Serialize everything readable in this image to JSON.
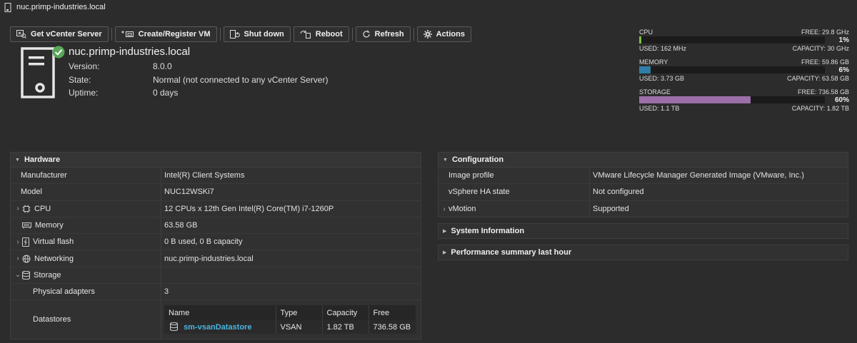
{
  "window": {
    "title": "nuc.primp-industries.local"
  },
  "toolbar": {
    "get_vcenter": "Get vCenter Server",
    "create_vm": "Create/Register VM",
    "shut_down": "Shut down",
    "reboot": "Reboot",
    "refresh": "Refresh",
    "actions": "Actions"
  },
  "host": {
    "name": "nuc.primp-industries.local",
    "version_label": "Version:",
    "version": "8.0.0",
    "state_label": "State:",
    "state": "Normal (not connected to any vCenter Server)",
    "uptime_label": "Uptime:",
    "uptime": "0 days"
  },
  "gauges": {
    "cpu": {
      "label": "CPU",
      "free": "FREE: 29.8 GHz",
      "pct": "1%",
      "used": "USED: 162 MHz",
      "capacity": "CAPACITY: 30 GHz",
      "fraction": 0.01,
      "color": "#7ac142"
    },
    "memory": {
      "label": "MEMORY",
      "free": "FREE: 59.86 GB",
      "pct": "6%",
      "used": "USED: 3.73 GB",
      "capacity": "CAPACITY: 63.58 GB",
      "fraction": 0.06,
      "color": "#2f7ea8"
    },
    "storage": {
      "label": "STORAGE",
      "free": "FREE: 736.58 GB",
      "pct": "60%",
      "used": "USED: 1.1 TB",
      "capacity": "CAPACITY: 1.82 TB",
      "fraction": 0.6,
      "color": "#9c6fa8"
    }
  },
  "hardware": {
    "title": "Hardware",
    "manufacturer_label": "Manufacturer",
    "manufacturer": "Intel(R) Client Systems",
    "model_label": "Model",
    "model": "NUC12WSKi7",
    "cpu_label": "CPU",
    "cpu": "12 CPUs x 12th Gen Intel(R) Core(TM) i7-1260P",
    "memory_label": "Memory",
    "memory": "63.58 GB",
    "vflash_label": "Virtual flash",
    "vflash": "0 B used, 0 B capacity",
    "networking_label": "Networking",
    "networking": "nuc.primp-industries.local",
    "storage_label": "Storage",
    "adapters_label": "Physical adapters",
    "adapters": "3",
    "datastores_label": "Datastores",
    "datastore_columns": [
      "Name",
      "Type",
      "Capacity",
      "Free"
    ],
    "datastores": [
      {
        "name": "sm-vsanDatastore",
        "type": "VSAN",
        "capacity": "1.82 TB",
        "free": "736.58 GB"
      }
    ]
  },
  "configuration": {
    "title": "Configuration",
    "image_label": "Image profile",
    "image": "VMware Lifecycle Manager Generated Image (VMware, Inc.)",
    "ha_label": "vSphere HA state",
    "ha": "Not configured",
    "vmotion_label": "vMotion",
    "vmotion": "Supported"
  },
  "system_info": {
    "title": "System Information"
  },
  "performance": {
    "title": "Performance summary last hour"
  }
}
